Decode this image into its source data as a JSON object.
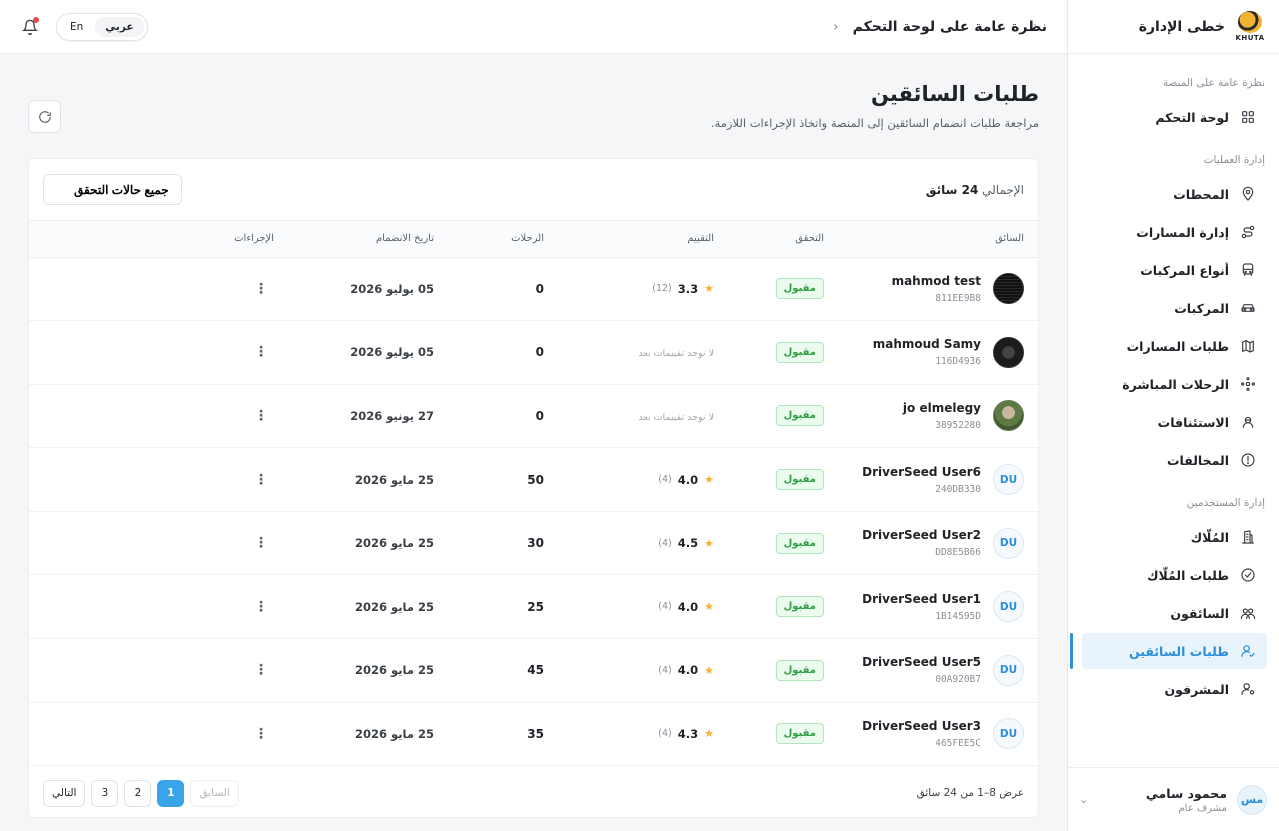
{
  "brand": {
    "name": "خطى الإدارة",
    "logo_text": "KHUTA"
  },
  "sidebar": {
    "sections": [
      {
        "title": "نظرة عامة على المنصة",
        "items": [
          {
            "label": "لوحة التحكم",
            "icon": "grid-icon"
          }
        ]
      },
      {
        "title": "إدارة العمليات",
        "items": [
          {
            "label": "المحطات",
            "icon": "map-pin-icon"
          },
          {
            "label": "إدارة المسارات",
            "icon": "route-icon"
          },
          {
            "label": "أنواع المركبات",
            "icon": "bus-icon"
          },
          {
            "label": "المركبات",
            "icon": "car-icon"
          },
          {
            "label": "طلبات المسارات",
            "icon": "map-icon"
          },
          {
            "label": "الرحلات المباشرة",
            "icon": "live-icon"
          },
          {
            "label": "الاستئنافات",
            "icon": "appeal-icon"
          },
          {
            "label": "المخالفات",
            "icon": "alert-icon"
          }
        ]
      },
      {
        "title": "إدارة المستخدمين",
        "items": [
          {
            "label": "المُلّاك",
            "icon": "building-icon"
          },
          {
            "label": "طلبات المُلّاك",
            "icon": "check-circle-icon"
          },
          {
            "label": "السائقون",
            "icon": "users-icon"
          },
          {
            "label": "طلبات السائقين",
            "icon": "user-check-icon"
          },
          {
            "label": "المشرفون",
            "icon": "user-gear-icon"
          }
        ]
      }
    ],
    "active": "طلبات السائقين",
    "user": {
      "initials": "مس",
      "name": "محمود سامي",
      "role": "مشرف عام"
    }
  },
  "topbar": {
    "title": "نظرة عامة على لوحة التحكم",
    "lang": {
      "ar": "عربي",
      "en": "En"
    }
  },
  "page": {
    "title": "طلبات السائقين",
    "subtitle": "مراجعة طلبات انضمام السائقين إلى المنصة واتخاذ الإجراءات اللازمة.",
    "total_label": "الإجمالي",
    "total_value": "24 سائق",
    "filter_label": "جميع حالات التحقق"
  },
  "table": {
    "headers": {
      "driver": "السائق",
      "verify": "التحقق",
      "rating": "التقييم",
      "trips": "الرحلات",
      "joined": "تاريخ الانضمام",
      "actions": "الإجراءات"
    },
    "no_rating": "لا توجد تقييمات بعد",
    "rows": [
      {
        "name": "mahmod test",
        "id": "811EE9B8",
        "avatar": "dark",
        "initials": "",
        "status": "مقبول",
        "rating": "3.3",
        "count": "(12)",
        "trips": "0",
        "joined": "05 يوليو 2026"
      },
      {
        "name": "mahmoud Samy",
        "id": "116D4936",
        "avatar": "dark2",
        "initials": "",
        "status": "مقبول",
        "rating": "",
        "count": "",
        "trips": "0",
        "joined": "05 يوليو 2026"
      },
      {
        "name": "jo elmelegy",
        "id": "38952280",
        "avatar": "photo",
        "initials": "",
        "status": "مقبول",
        "rating": "",
        "count": "",
        "trips": "0",
        "joined": "27 يونيو 2026"
      },
      {
        "name": "DriverSeed User6",
        "id": "240DB330",
        "avatar": "initials",
        "initials": "DU",
        "status": "مقبول",
        "rating": "4.0",
        "count": "(4)",
        "trips": "50",
        "joined": "25 مايو 2026"
      },
      {
        "name": "DriverSeed User2",
        "id": "DD8E5B66",
        "avatar": "initials",
        "initials": "DU",
        "status": "مقبول",
        "rating": "4.5",
        "count": "(4)",
        "trips": "30",
        "joined": "25 مايو 2026"
      },
      {
        "name": "DriverSeed User1",
        "id": "1B14595D",
        "avatar": "initials",
        "initials": "DU",
        "status": "مقبول",
        "rating": "4.0",
        "count": "(4)",
        "trips": "25",
        "joined": "25 مايو 2026"
      },
      {
        "name": "DriverSeed User5",
        "id": "00A920B7",
        "avatar": "initials",
        "initials": "DU",
        "status": "مقبول",
        "rating": "4.0",
        "count": "(4)",
        "trips": "45",
        "joined": "25 مايو 2026"
      },
      {
        "name": "DriverSeed User3",
        "id": "465FEE5C",
        "avatar": "initials",
        "initials": "DU",
        "status": "مقبول",
        "rating": "4.3",
        "count": "(4)",
        "trips": "35",
        "joined": "25 مايو 2026"
      }
    ]
  },
  "footer": {
    "info": "عرض 8–1 من 24 سائق",
    "prev": "السابق",
    "next": "التالي",
    "pages": [
      "1",
      "2",
      "3"
    ],
    "current": "1"
  },
  "colors": {
    "accent": "#2b8fd9",
    "success": "#2f9e44",
    "star": "#f2b233"
  }
}
